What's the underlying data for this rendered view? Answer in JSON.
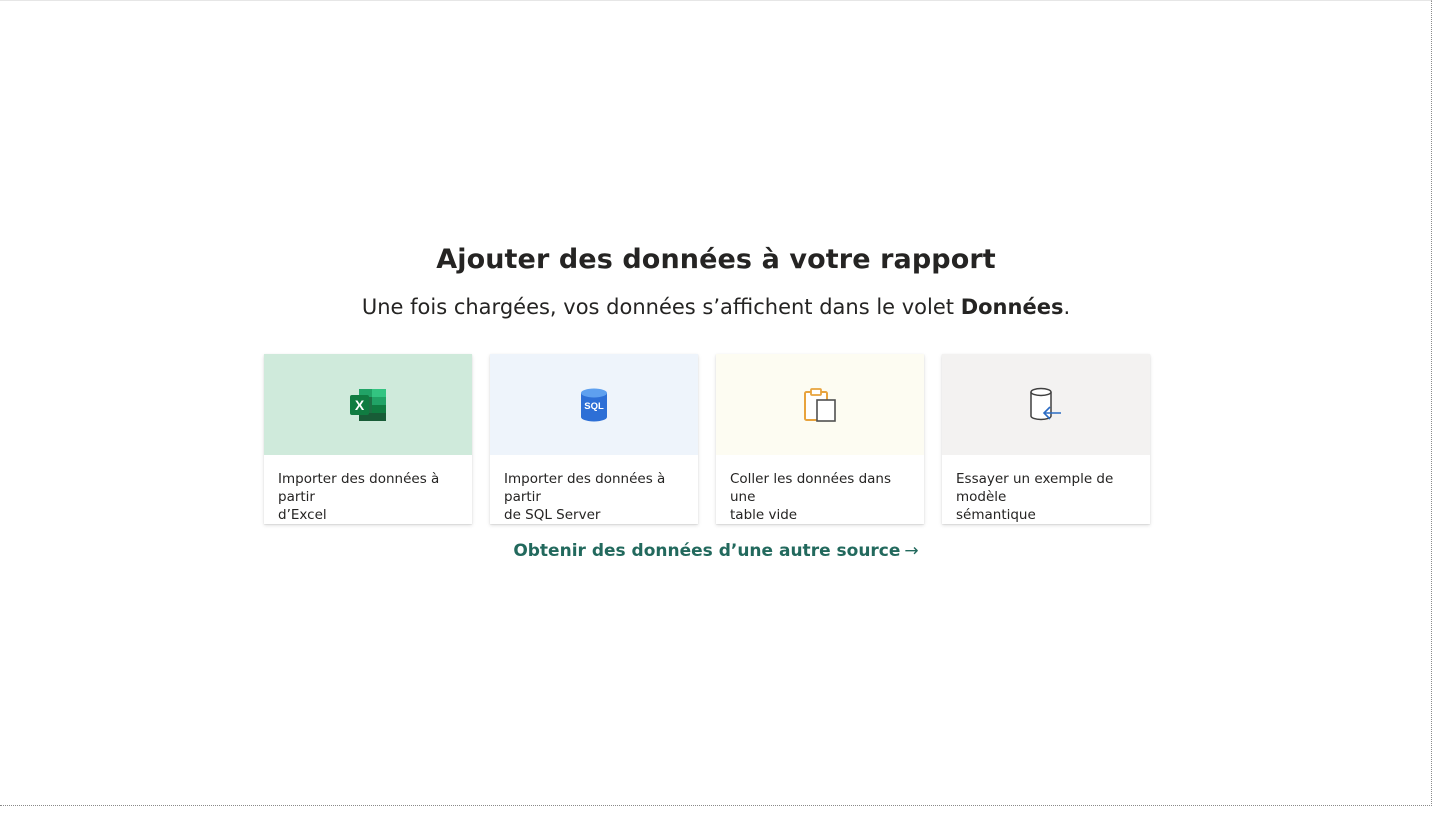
{
  "main": {
    "title": "Ajouter des données à votre rapport",
    "subtitle_prefix": "Une fois chargées, vos données s’affichent dans le volet ",
    "subtitle_bold": "Données",
    "subtitle_suffix": ".",
    "cards": [
      {
        "label": "Importer des données à partir\nd’Excel",
        "icon": "excel-icon",
        "bg": "#cfeadb"
      },
      {
        "label": "Importer des données à partir\nde SQL Server",
        "icon": "sql-server-icon",
        "bg": "#eef4fb"
      },
      {
        "label": "Coller les données dans une\ntable vide",
        "icon": "clipboard-icon",
        "bg": "#fdfcf2"
      },
      {
        "label": "Essayer un exemple de modèle\nsémantique",
        "icon": "sample-dataset-icon",
        "bg": "#f3f2f1"
      }
    ],
    "other_source_link": "Obtenir des données d’une autre source",
    "link_arrow": "→"
  },
  "colors": {
    "accent_link": "#22695d",
    "excel_green": "#1e7145",
    "sql_blue": "#2d6fd6",
    "clipboard_orange": "#e8a33d"
  }
}
